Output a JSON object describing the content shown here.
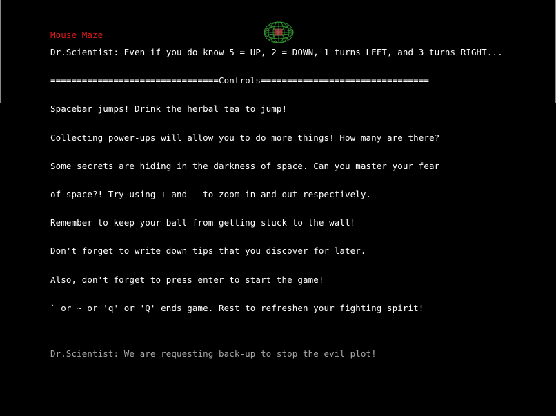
{
  "game": {
    "title": "Mouse Maze",
    "intro_line": "Dr.Scientist: Even if you do know 5 = UP, 2 = DOWN, 1 turns LEFT, and 3 turns RIGHT...",
    "controls_header": "================================Controls================================",
    "tips": [
      "Spacebar jumps! Drink the herbal tea to jump!",
      "Collecting power-ups will allow you to do more things! How many are there?",
      "Some secrets are hiding in the darkness of space. Can you master your fear",
      "of space?! Try using + and - to zoom in and out respectively.",
      "Remember to keep your ball from getting stuck to the wall!",
      "Don't forget to write down tips that you discover for later.",
      "Also, don't forget to press enter to start the game!",
      "` or ~ or 'q' or 'Q' ends game. Rest to refreshen your fighting spirit!"
    ],
    "footer_line": "Dr.Scientist: We are requesting back-up to stop the evil plot!"
  },
  "colors": {
    "background": "#000000",
    "title": "#e01a1a",
    "text": "#ffffff",
    "footer": "#a8a8a8",
    "globe_wire": "#2f8f2f",
    "globe_core": "#8b2e2e"
  },
  "icons": {
    "globe": "wireframe-globe-icon"
  }
}
